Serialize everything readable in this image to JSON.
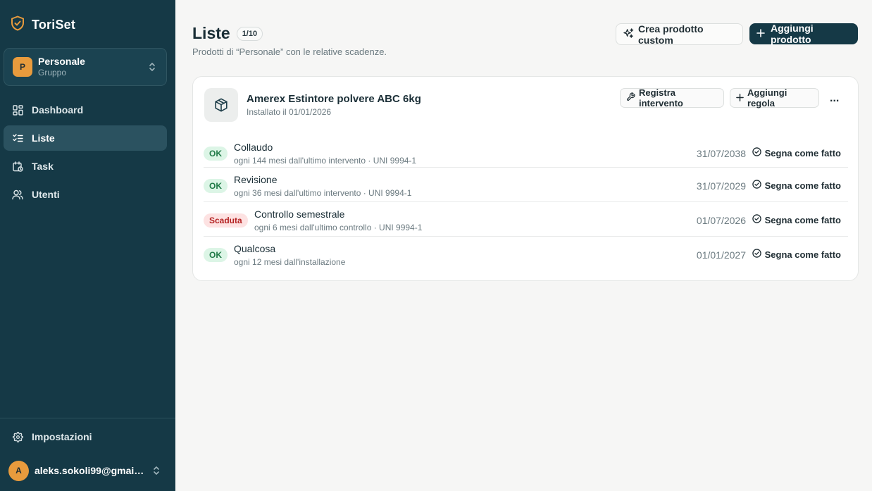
{
  "app": {
    "name": "ToriSet",
    "logo_icon": "shield-check-icon"
  },
  "group": {
    "initial": "P",
    "name": "Personale",
    "type": "Gruppo"
  },
  "nav": [
    {
      "label": "Dashboard",
      "icon": "grid-icon",
      "active": false
    },
    {
      "label": "Liste",
      "icon": "list-check-icon",
      "active": true
    },
    {
      "label": "Task",
      "icon": "calendar-clock-icon",
      "active": false
    },
    {
      "label": "Utenti",
      "icon": "users-icon",
      "active": false
    }
  ],
  "settings_label": "Impostazioni",
  "user": {
    "initial": "A",
    "email": "aleks.sokoli99@gmail.com"
  },
  "header": {
    "title": "Liste",
    "count": "1/10",
    "subtitle": "Prodotti di “Personale” con le relative scadenze.",
    "custom_button": "Crea prodotto custom",
    "add_button": "Aggiungi prodotto"
  },
  "product": {
    "name": "Amerex Estintore polvere ABC 6kg",
    "installed": "Installato il 01/01/2026",
    "register_button": "Registra intervento",
    "add_rule_button": "Aggiungi regola",
    "more": "..."
  },
  "rules": [
    {
      "status": "OK",
      "status_type": "ok",
      "title": "Collaudo",
      "detail": "ogni 144 mesi dall'ultimo intervento · UNI 9994-1",
      "date": "31/07/2038",
      "action": "Segna come fatto"
    },
    {
      "status": "OK",
      "status_type": "ok",
      "title": "Revisione",
      "detail": "ogni 36 mesi dall'ultimo intervento · UNI 9994-1",
      "date": "31/07/2029",
      "action": "Segna come fatto"
    },
    {
      "status": "Scaduta",
      "status_type": "expired",
      "title": "Controllo semestrale",
      "detail": "ogni 6 mesi dall'ultimo controllo · UNI 9994-1",
      "date": "01/07/2026",
      "action": "Segna come fatto"
    },
    {
      "status": "OK",
      "status_type": "ok",
      "title": "Qualcosa",
      "detail": "ogni 12 mesi dall'installazione",
      "date": "01/01/2027",
      "action": "Segna come fatto"
    }
  ],
  "colors": {
    "sidebar": "#153946",
    "accent": "#e89b3d",
    "ok": "#1f7a47",
    "expired": "#b42323"
  }
}
